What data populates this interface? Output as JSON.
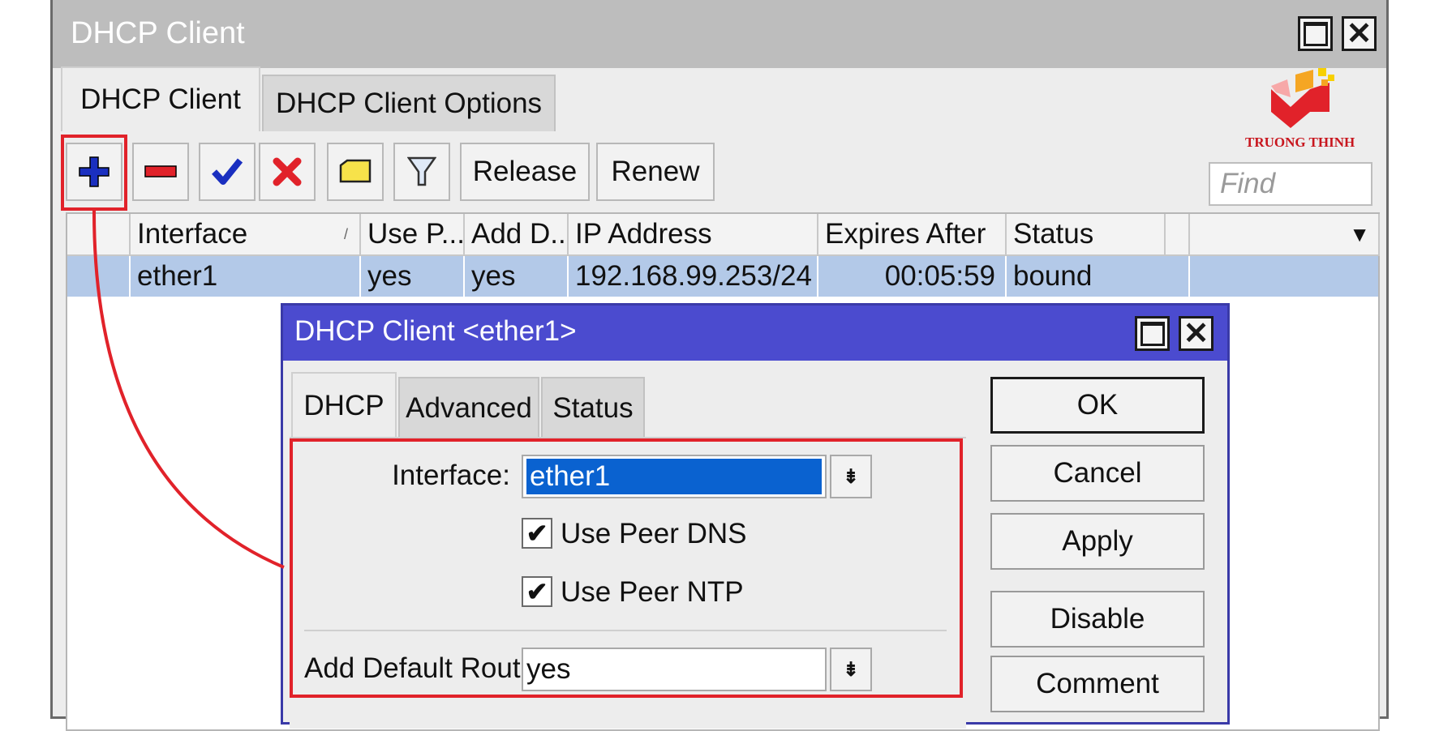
{
  "window": {
    "title": "DHCP Client"
  },
  "tabs": [
    {
      "label": "DHCP Client",
      "active": true
    },
    {
      "label": "DHCP Client Options",
      "active": false
    }
  ],
  "toolbar": {
    "tools": [
      "add-icon",
      "remove-icon",
      "enable-icon",
      "disable-icon",
      "comment-icon",
      "filter-icon"
    ],
    "release_label": "Release",
    "renew_label": "Renew",
    "find_placeholder": "Find"
  },
  "logo": {
    "text": "TRUONG THINH",
    "colors": [
      "#e1222a",
      "#f5a623",
      "#f7d000"
    ]
  },
  "table": {
    "columns": [
      "Interface",
      "Use P...",
      "Add D...",
      "IP Address",
      "Expires After",
      "Status"
    ],
    "rows": [
      {
        "interface": "ether1",
        "use_peer": "yes",
        "add_default": "yes",
        "ip": "192.168.99.253/24",
        "expires": "00:05:59",
        "status": "bound"
      }
    ]
  },
  "dialog": {
    "title": "DHCP Client <ether1>",
    "tabs": [
      {
        "label": "DHCP",
        "active": true
      },
      {
        "label": "Advanced",
        "active": false
      },
      {
        "label": "Status",
        "active": false
      }
    ],
    "fields": {
      "interface_label": "Interface:",
      "interface_value": "ether1",
      "use_peer_dns_label": "Use Peer DNS",
      "use_peer_dns_checked": true,
      "use_peer_ntp_label": "Use Peer NTP",
      "use_peer_ntp_checked": true,
      "add_default_route_label": "Add Default Route:",
      "add_default_route_value": "yes"
    },
    "buttons": {
      "ok": "OK",
      "cancel": "Cancel",
      "apply": "Apply",
      "disable": "Disable",
      "comment": "Comment"
    }
  },
  "colors": {
    "highlight": "#e1222a",
    "dialog_title": "#4b4bcf",
    "selected_row": "#b3c9e8",
    "selected_text": "#0a62d0"
  }
}
